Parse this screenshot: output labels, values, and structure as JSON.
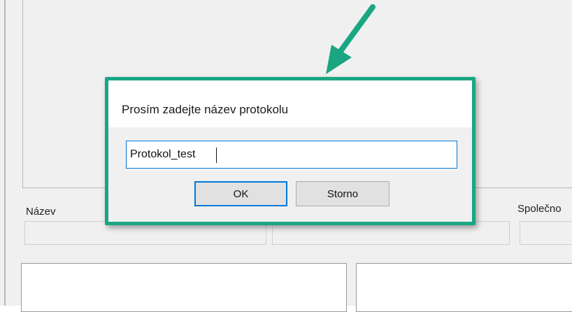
{
  "background": {
    "labels": {
      "nazev": "Název",
      "spolecnost": "Společno"
    }
  },
  "dialog": {
    "title": "Prosím zadejte název protokolu",
    "input_value": "Protokol_test",
    "ok_label": "OK",
    "cancel_label": "Storno"
  },
  "colors": {
    "highlight": "#1aa683",
    "focus_blue": "#0078d7",
    "arrow": "#1aa683"
  },
  "icons": [
    "annotation-arrow-icon"
  ]
}
